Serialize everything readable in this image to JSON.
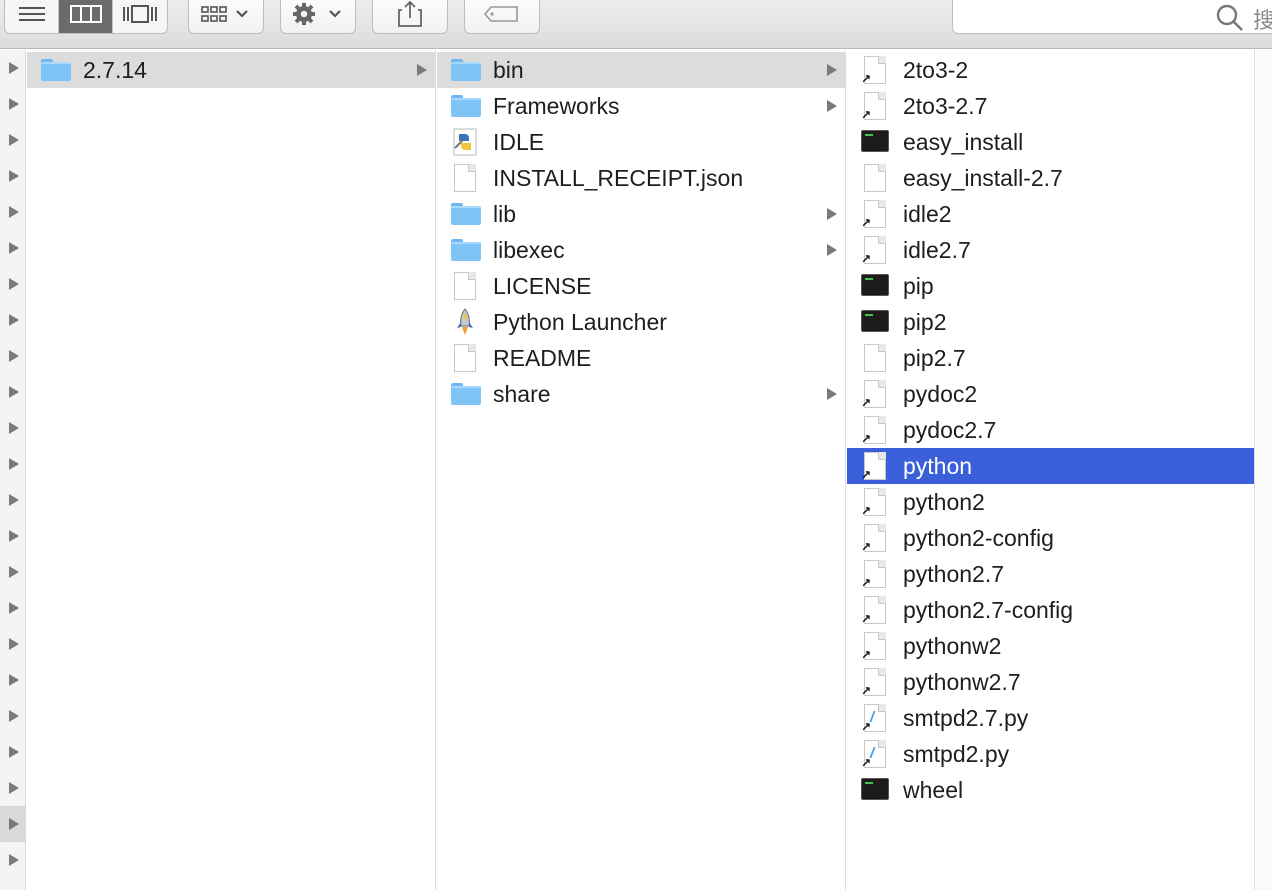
{
  "toolbar": {
    "view_modes": [
      {
        "id": "list",
        "icon": "list-view-icon",
        "active": false
      },
      {
        "id": "column",
        "icon": "column-view-icon",
        "active": true
      },
      {
        "id": "coverflow",
        "icon": "coverflow-view-icon",
        "active": false
      }
    ],
    "group_icon": "group-by-icon",
    "action_icon": "gear-icon",
    "share_icon": "share-icon",
    "tags_icon": "tag-icon",
    "search": {
      "placeholder": "搜",
      "icon": "search-icon"
    }
  },
  "columns": [
    {
      "name": "root",
      "items": [
        {
          "label": "2.7.14",
          "type": "folder",
          "has_children": true,
          "selected": "gray"
        }
      ]
    },
    {
      "name": "version",
      "items": [
        {
          "label": "bin",
          "type": "folder",
          "has_children": true,
          "selected": "gray"
        },
        {
          "label": "Frameworks",
          "type": "folder",
          "has_children": true
        },
        {
          "label": "IDLE",
          "type": "app-idle",
          "has_children": false
        },
        {
          "label": "INSTALL_RECEIPT.json",
          "type": "document",
          "has_children": false
        },
        {
          "label": "lib",
          "type": "folder",
          "has_children": true
        },
        {
          "label": "libexec",
          "type": "folder",
          "has_children": true
        },
        {
          "label": "LICENSE",
          "type": "document",
          "has_children": false
        },
        {
          "label": "Python Launcher",
          "type": "app-launcher",
          "has_children": false
        },
        {
          "label": "README",
          "type": "document",
          "has_children": false
        },
        {
          "label": "share",
          "type": "folder",
          "has_children": true
        }
      ]
    },
    {
      "name": "bin",
      "items": [
        {
          "label": "2to3-2",
          "type": "alias"
        },
        {
          "label": "2to3-2.7",
          "type": "alias"
        },
        {
          "label": "easy_install",
          "type": "exec"
        },
        {
          "label": "easy_install-2.7",
          "type": "document"
        },
        {
          "label": "idle2",
          "type": "alias"
        },
        {
          "label": "idle2.7",
          "type": "alias"
        },
        {
          "label": "pip",
          "type": "exec"
        },
        {
          "label": "pip2",
          "type": "exec"
        },
        {
          "label": "pip2.7",
          "type": "document"
        },
        {
          "label": "pydoc2",
          "type": "alias"
        },
        {
          "label": "pydoc2.7",
          "type": "alias"
        },
        {
          "label": "python",
          "type": "alias",
          "selected": "blue"
        },
        {
          "label": "python2",
          "type": "alias"
        },
        {
          "label": "python2-config",
          "type": "alias"
        },
        {
          "label": "python2.7",
          "type": "alias"
        },
        {
          "label": "python2.7-config",
          "type": "alias"
        },
        {
          "label": "pythonw2",
          "type": "alias"
        },
        {
          "label": "pythonw2.7",
          "type": "alias"
        },
        {
          "label": "smtpd2.7.py",
          "type": "alias-script"
        },
        {
          "label": "smtpd2.py",
          "type": "alias-script"
        },
        {
          "label": "wheel",
          "type": "exec"
        }
      ]
    }
  ],
  "colors": {
    "selection_blue": "#3a5fd8",
    "selection_gray": "#dcdcdc",
    "folder": "#7fc4f7"
  }
}
